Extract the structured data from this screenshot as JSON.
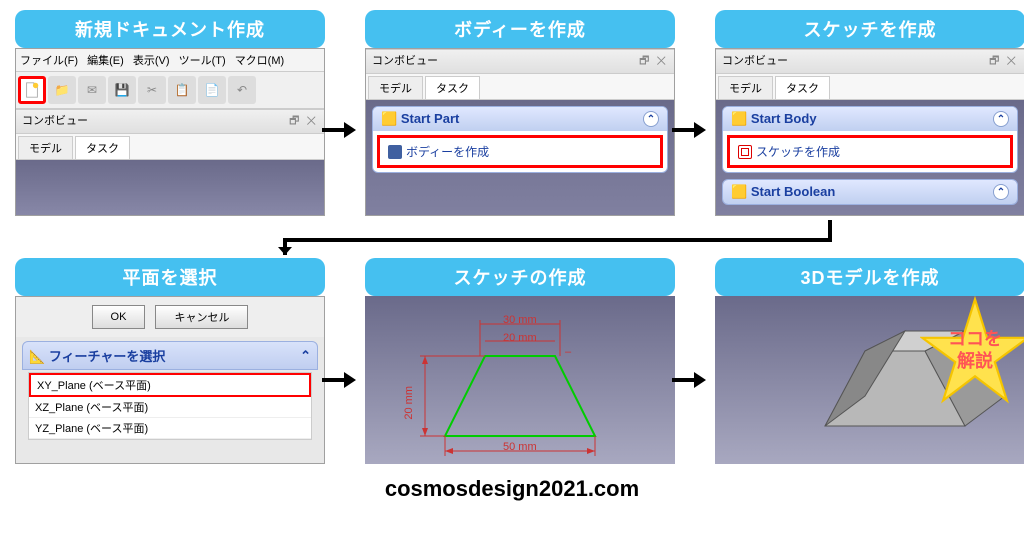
{
  "steps": {
    "s1": {
      "title": "新規ドキュメント作成"
    },
    "s2": {
      "title": "ボディーを作成"
    },
    "s3": {
      "title": "スケッチを作成"
    },
    "s4": {
      "title": "平面を選択"
    },
    "s5": {
      "title": "スケッチの作成"
    },
    "s6": {
      "title": "3Dモデルを作成"
    }
  },
  "menubar": {
    "file": "ファイル(F)",
    "edit": "編集(E)",
    "view": "表示(V)",
    "tools": "ツール(T)",
    "macro": "マクロ(M)"
  },
  "combo": {
    "title": "コンボビュー",
    "tab_model": "モデル",
    "tab_task": "タスク"
  },
  "tasks": {
    "start_part": "Start Part",
    "create_body": "ボディーを作成",
    "start_body": "Start Body",
    "create_sketch": "スケッチを作成",
    "start_boolean": "Start Boolean"
  },
  "dialog": {
    "ok": "OK",
    "cancel": "キャンセル",
    "feat_title": "フィーチャーを選択",
    "xy": "XY_Plane (ベース平面)",
    "xz": "XZ_Plane (ベース平面)",
    "yz": "YZ_Plane (ベース平面)"
  },
  "sketch": {
    "dim_top1": "30 mm",
    "dim_top2": "20 mm",
    "dim_left": "20 mm",
    "dim_bottom": "50 mm",
    "dash": "–"
  },
  "star": {
    "line1": "ココを",
    "line2": "解説"
  },
  "footer": "cosmosdesign2021.com"
}
